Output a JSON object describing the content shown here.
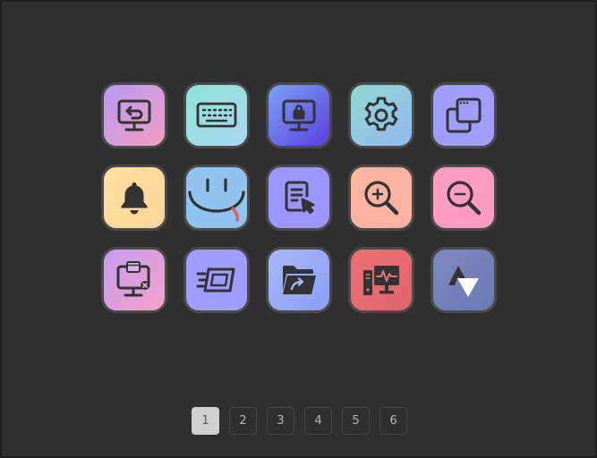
{
  "icons": [
    {
      "name": "screen-restore-icon",
      "gradient": [
        "#b69af2",
        "#f39ec4"
      ]
    },
    {
      "name": "keyboard-icon",
      "gradient": [
        "#8ee3d3",
        "#a9d8f2"
      ]
    },
    {
      "name": "screen-lock-icon",
      "gradient": [
        "#7ba2f5",
        "#5b3fe0"
      ]
    },
    {
      "name": "gear-icon",
      "gradient": [
        "#8fd8d0",
        "#95b8ef"
      ]
    },
    {
      "name": "window-copy-icon",
      "gradient": [
        "#a09dff",
        "#a09dff"
      ]
    },
    {
      "name": "bell-icon",
      "gradient": [
        "#ffe0a0",
        "#ffd59a"
      ]
    },
    {
      "name": "smiley-face-icon",
      "gradient": [
        "#90c4ef",
        "#90c4ef"
      ]
    },
    {
      "name": "document-cursor-icon",
      "gradient": [
        "#9b97ff",
        "#9b97ff"
      ]
    },
    {
      "name": "zoom-in-icon",
      "gradient": [
        "#ffb6a0",
        "#ffb0a2"
      ]
    },
    {
      "name": "zoom-out-icon",
      "gradient": [
        "#ff9cc4",
        "#ff9cc4"
      ]
    },
    {
      "name": "screen-close-window-icon",
      "gradient": [
        "#c49cf0",
        "#f4a2c8"
      ]
    },
    {
      "name": "fast-window-icon",
      "gradient": [
        "#a19cff",
        "#a19cff"
      ]
    },
    {
      "name": "folder-share-icon",
      "gradient": [
        "#a9b7f8",
        "#8a9ef5"
      ]
    },
    {
      "name": "computer-monitor-activity-icon",
      "gradient": [
        "#ee6f76",
        "#e0646c"
      ]
    },
    {
      "name": "up-down-arrows-logo-icon",
      "gradient": [
        "#7d89c0",
        "#6b79b3"
      ]
    }
  ],
  "pagination": {
    "pages": [
      "1",
      "2",
      "3",
      "4",
      "5",
      "6"
    ],
    "active": "1"
  }
}
